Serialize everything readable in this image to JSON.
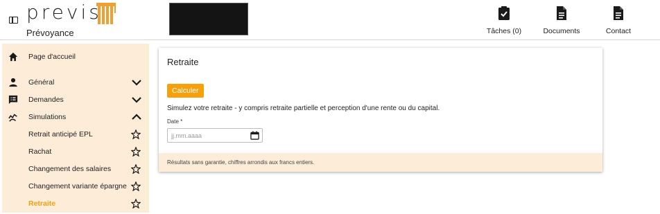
{
  "header": {
    "logo_word": "previs",
    "logo_sub": "Prévoyance",
    "menu_icon": "sidebar-toggle-icon",
    "actions": [
      {
        "label": "Tâches (0)",
        "icon": "clipboard-check-icon"
      },
      {
        "label": "Documents",
        "icon": "document-icon"
      },
      {
        "label": "Contact",
        "icon": "document-icon"
      }
    ]
  },
  "sidebar": {
    "items": [
      {
        "label": "Page d'accueil",
        "icon": "home-icon"
      },
      {
        "label": "Général",
        "icon": "person-icon",
        "chevron": "down"
      },
      {
        "label": "Demandes",
        "icon": "message-list-icon",
        "chevron": "down"
      },
      {
        "label": "Simulations",
        "icon": "chart-hand-icon",
        "chevron": "up"
      },
      {
        "label": "Retrait anticipé EPL",
        "icon": "star-icon"
      },
      {
        "label": "Rachat",
        "icon": "star-icon"
      },
      {
        "label": "Changement des salaires",
        "icon": "star-icon"
      },
      {
        "label": "Changement variante épargne",
        "icon": "star-icon"
      },
      {
        "label": "Retraite",
        "icon": "star-icon",
        "active": true
      }
    ]
  },
  "main": {
    "title": "Retraite",
    "calc_button": "Calculer",
    "description": "Simulez votre retraite - y compris retraite partielle et perception d'une rente ou du capital.",
    "date_label": "Date *",
    "date_placeholder": "jj.mm.aaaa",
    "footer_note": "Résultats sans garantie, chiffres arrondis aux francs entiers."
  },
  "colors": {
    "accent": "#f5a00c",
    "sidebar_bg": "#fcecd8",
    "active_text": "#f0a010"
  }
}
